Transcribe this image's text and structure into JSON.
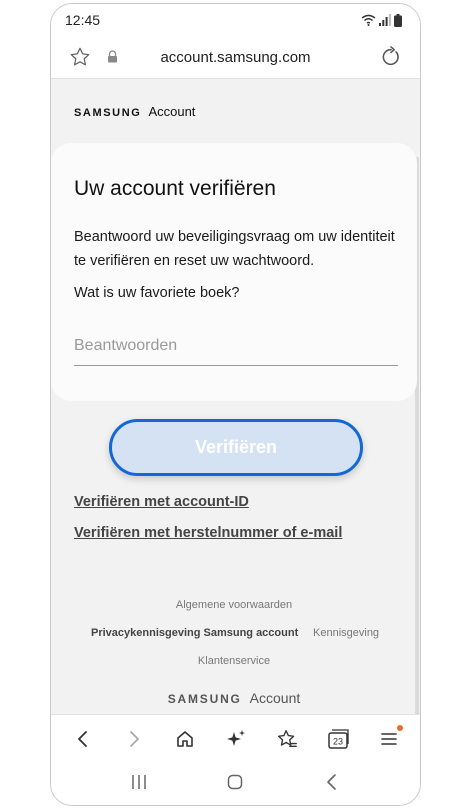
{
  "status_bar": {
    "time": "12:45"
  },
  "browser": {
    "url": "account.samsung.com"
  },
  "brand": {
    "samsung": "SAMSUNG",
    "account": "Account"
  },
  "card": {
    "title": "Uw account verifiëren",
    "description": "Beantwoord uw beveiligingsvraag om uw identiteit te verifiëren en reset uw wachtwoord.",
    "question": "Wat is uw favoriete boek?",
    "answer_placeholder": "Beantwoorden",
    "answer_value": ""
  },
  "verify_button": {
    "label": "Verifiëren"
  },
  "links": {
    "account_id": "Verifiëren met account-ID",
    "recovery": "Verifiëren met herstelnummer of e-mail"
  },
  "footer": {
    "terms": "Algemene voorwaarden",
    "privacy": "Privacykennisgeving Samsung account",
    "notice": "Kennisgeving",
    "support": "Klantenservice",
    "brand_samsung": "SAMSUNG",
    "brand_account": "Account"
  },
  "toolbar": {
    "tabs_count": "23",
    "icons": [
      "back-icon",
      "forward-icon",
      "home-icon",
      "sparkle-icon",
      "bookmarks-icon",
      "tabs-icon",
      "menu-icon"
    ]
  },
  "colors": {
    "accent": "#1467d6",
    "button_fill": "#d4e2f4",
    "notification_dot": "#e86b2a"
  }
}
